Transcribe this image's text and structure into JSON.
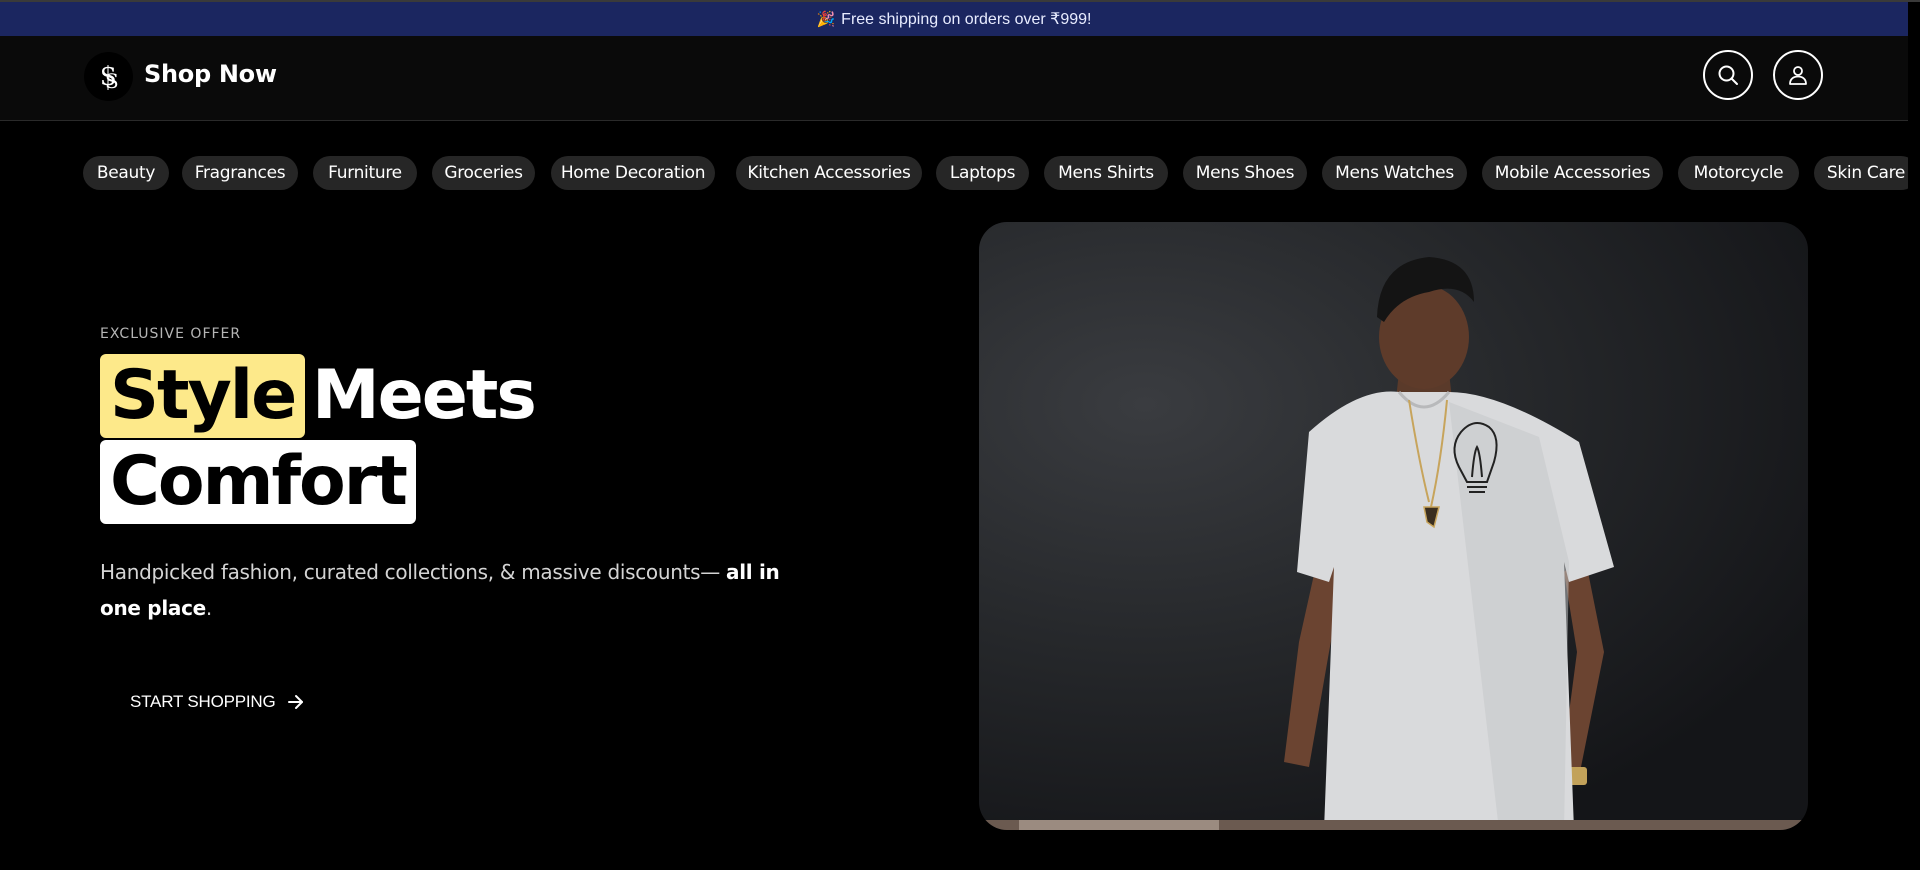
{
  "announcement": {
    "icon": "party-popper-icon",
    "text": "Free shipping on orders over ₹999!"
  },
  "header": {
    "brand": "Shop Now",
    "logo_icon": "ss-monogram-logo",
    "actions": [
      {
        "name": "search",
        "icon": "search-icon"
      },
      {
        "name": "account",
        "icon": "user-icon"
      }
    ]
  },
  "categories": [
    "Beauty",
    "Fragrances",
    "Furniture",
    "Groceries",
    "Home Decoration",
    "Kitchen Accessories",
    "Laptops",
    "Mens Shirts",
    "Mens Shoes",
    "Mens Watches",
    "Mobile Accessories",
    "Motorcycle",
    "Skin Care"
  ],
  "hero": {
    "eyebrow": "EXCLUSIVE OFFER",
    "headline_highlight": "Style",
    "headline_rest": "Meets",
    "headline_line2": "Comfort",
    "subtext_plain": "Handpicked fashion, curated collections, & massive discounts— ",
    "subtext_bold": "all in one place",
    "subtext_end": ".",
    "cta_label": "START SHOPPING",
    "cta_icon": "arrow-right-icon",
    "image_subject": "man in white t-shirt with lightbulb print"
  },
  "colors": {
    "announcement_bg": "#1b2660",
    "header_bg": "#0a0a0a",
    "page_bg": "#000000",
    "pill_bg": "#262626",
    "highlight_yellow": "#fde98a"
  }
}
